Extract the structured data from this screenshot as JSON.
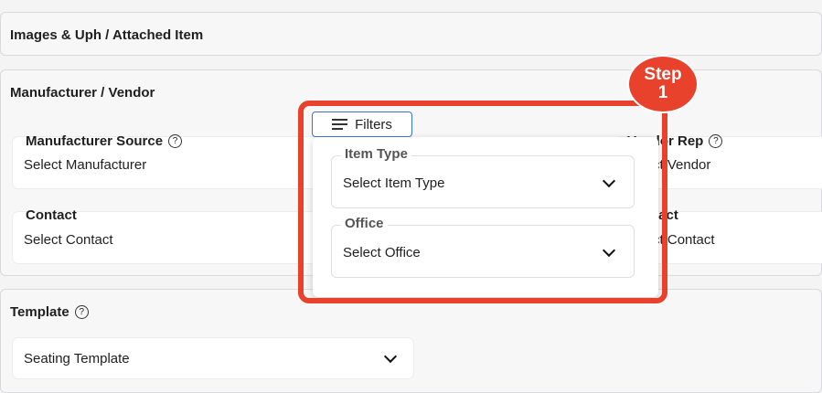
{
  "sections": {
    "images": {
      "title": "Images & Uph / Attached Item"
    },
    "manufacturer": {
      "title": "Manufacturer / Vendor",
      "manufacturer_source": {
        "label": "Manufacturer Source",
        "value": "Select Manufacturer"
      },
      "contact_left": {
        "label": "Contact",
        "value": "Select Contact"
      },
      "vendor_rep": {
        "label": "Vendor Rep",
        "value": "Select Vendor"
      },
      "contact_right": {
        "label": "Contact",
        "value": "Select Contact"
      }
    },
    "template": {
      "title": "Template",
      "value": "Seating Template"
    }
  },
  "filters": {
    "button_label": "Filters",
    "item_type": {
      "label": "Item Type",
      "value": "Select Item Type"
    },
    "office": {
      "label": "Office",
      "value": "Select Office"
    }
  },
  "annotation": {
    "step_word": "Step",
    "step_number": "1",
    "color": "#e8412c"
  },
  "icons": {
    "help": "help-circle-icon",
    "filter": "filter-lines-icon",
    "dropdown": "chevron-down-icon"
  }
}
